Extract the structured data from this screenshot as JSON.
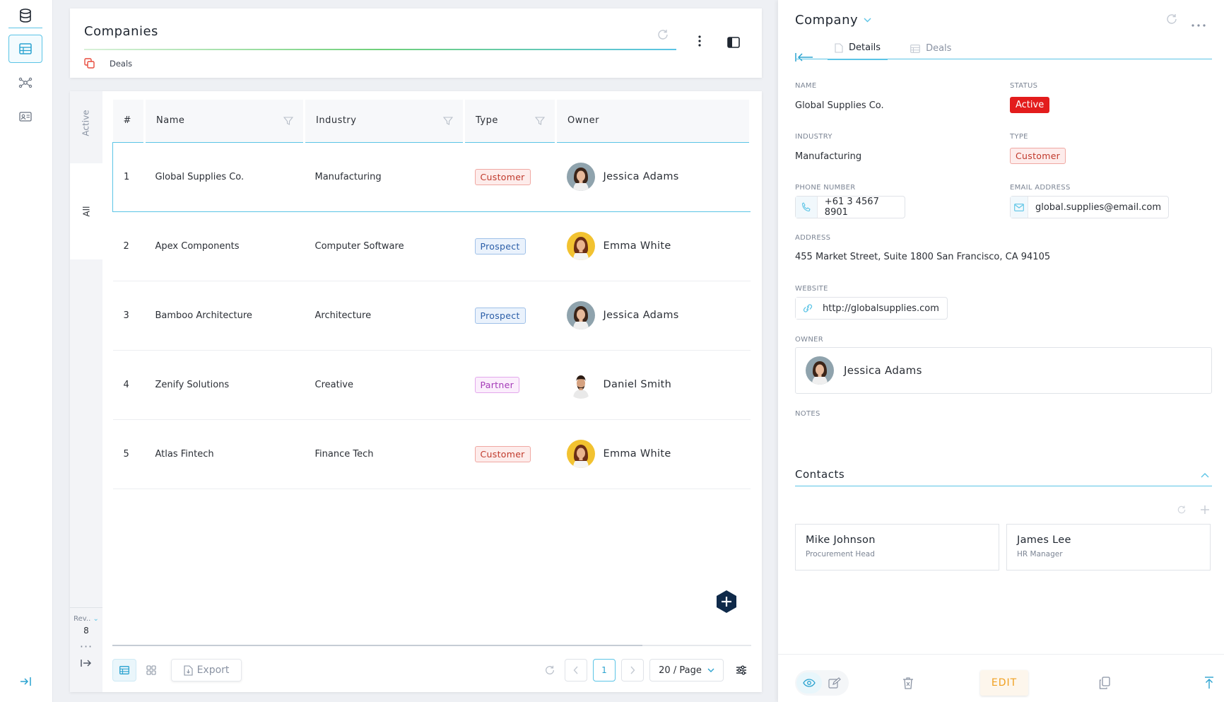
{
  "rail": {
    "icons": [
      "database-icon",
      "table-icon",
      "network-icon",
      "contact-card-icon",
      "collapse-right-icon"
    ]
  },
  "list": {
    "title": "Companies",
    "breadcrumb": "Deals",
    "view_tabs": [
      "Active",
      "All"
    ],
    "selected_view_tab": "All",
    "revision_label": "Rev..",
    "revision_value": "8",
    "columns": [
      "#",
      "Name",
      "Industry",
      "Type",
      "Owner"
    ],
    "rows": [
      {
        "num": "1",
        "name": "Global Supplies Co.",
        "industry": "Manufacturing",
        "type": "Customer",
        "owner": "Jessica Adams"
      },
      {
        "num": "2",
        "name": "Apex Components",
        "industry": "Computer Software",
        "type": "Prospect",
        "owner": "Emma White"
      },
      {
        "num": "3",
        "name": "Bamboo Architecture",
        "industry": "Architecture",
        "type": "Prospect",
        "owner": "Jessica Adams"
      },
      {
        "num": "4",
        "name": "Zenify Solutions",
        "industry": "Creative",
        "type": "Partner",
        "owner": "Daniel Smith"
      },
      {
        "num": "5",
        "name": "Atlas Fintech",
        "industry": "Finance Tech",
        "type": "Customer",
        "owner": "Emma White"
      }
    ],
    "footer": {
      "export_label": "Export",
      "current_page": "1",
      "page_size": "20 / Page"
    }
  },
  "detail": {
    "title": "Company",
    "tabs": [
      "Details",
      "Deals"
    ],
    "selected_tab": "Details",
    "fields": {
      "name_label": "NAME",
      "name_value": "Global Supplies Co.",
      "status_label": "STATUS",
      "status_value": "Active",
      "industry_label": "INDUSTRY",
      "industry_value": "Manufacturing",
      "type_label": "TYPE",
      "type_value": "Customer",
      "phone_label": "PHONE NUMBER",
      "phone_value": "+61 3 4567 8901",
      "email_label": "EMAIL ADDRESS",
      "email_value": "global.supplies@email.com",
      "address_label": "ADDRESS",
      "address_value": "455 Market Street, Suite 1800 San Francisco, CA 94105",
      "website_label": "WEBSITE",
      "website_value": "http://globalsupplies.com",
      "owner_label": "OWNER",
      "owner_value": "Jessica Adams",
      "notes_label": "NOTES"
    },
    "contacts": {
      "title": "Contacts",
      "items": [
        {
          "name": "Mike Johnson",
          "role": "Procurement Head"
        },
        {
          "name": "James Lee",
          "role": "HR Manager"
        }
      ]
    },
    "footer": {
      "edit_label": "EDIT"
    }
  },
  "colors": {
    "accent": "#5bc4e6",
    "status_active": "#e31c1c",
    "edit_orange": "#f0a020",
    "fab_navy": "#0f2a4a"
  }
}
